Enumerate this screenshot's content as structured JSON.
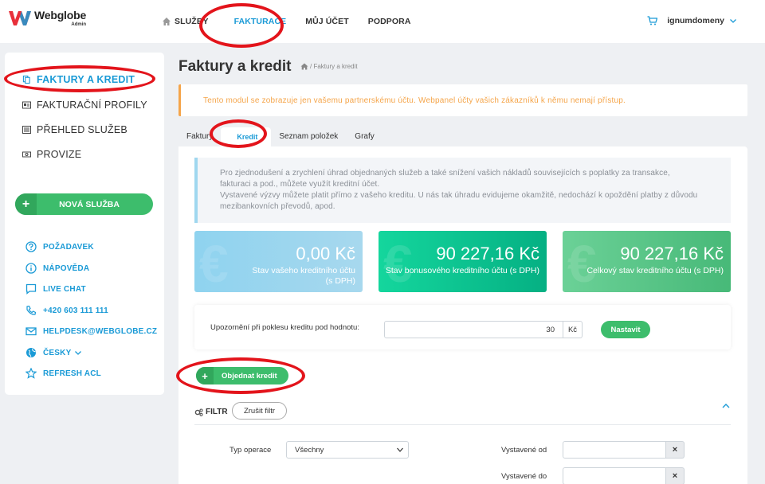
{
  "header": {
    "brand": "Webglobe",
    "brand_sub": "Admin",
    "nav": [
      "SLUŽBY",
      "FAKTURACE",
      "MŮJ ÚČET",
      "PODPORA"
    ],
    "user": "ignumdomeny"
  },
  "sidebar": {
    "items": [
      "FAKTURY A KREDIT",
      "FAKTURAČNÍ PROFILY",
      "PŘEHLED SLUŽEB",
      "PROVIZE"
    ],
    "new_service": "NOVÁ SLUŽBA",
    "help": [
      "POŽADAVEK",
      "NÁPOVĚDA",
      "LIVE CHAT",
      "+420 603 111 111",
      "HELPDESK@WEBGLOBE.CZ",
      "ČESKY",
      "REFRESH ACL"
    ]
  },
  "main": {
    "title": "Faktury a kredit",
    "breadcrumb": "/ Faktury a kredit",
    "alert": "Tento modul se zobrazuje jen vašemu partnerskému účtu. Webpanel účty vašich zákazníků k němu nemají přístup.",
    "tabs": [
      "Faktury",
      "Kredit",
      "Seznam položek",
      "Grafy"
    ],
    "info_line1": "Pro zjednodušení a zrychlení úhrad objednaných služeb a také snížení vašich nákladů souvisejících s poplatky za transakce,",
    "info_line2": "fakturaci a pod., můžete využít kreditní účet.",
    "info_line3": "Vystavené výzvy můžete platit přímo z vašeho kreditu. U nás tak úhradu evidujeme okamžitě, nedochází k opoždění platby z důvodu",
    "info_line4": "mezibankovních převodů, apod.",
    "cards": [
      {
        "amount": "0,00 Kč",
        "desc1": "Stav vašeho kreditního účtu",
        "desc2": "(s DPH)"
      },
      {
        "amount": "90 227,16 Kč",
        "desc1": "Stav bonusového kreditního účtu (s DPH)",
        "desc2": ""
      },
      {
        "amount": "90 227,16 Kč",
        "desc1": "Celkový stav kreditního účtu (s DPH)",
        "desc2": ""
      }
    ],
    "card_symbol": "€",
    "notify_label": "Upozornění při poklesu kreditu pod hodnotu:",
    "notify_value": "30",
    "notify_unit": "Kč",
    "notify_button": "Nastavit",
    "order_button": "Objednat kredit",
    "filter_label": "FILTR",
    "clear_filter": "Zrušit filtr",
    "type_label": "Typ operace",
    "type_value": "Všechny",
    "issued_from": "Vystavené od",
    "issued_to": "Vystavené do",
    "clear_symbol": "×"
  },
  "colors": {
    "accent": "#1a9ad6",
    "green": "#3dbd6c",
    "alert": "#f5a54a",
    "annotation": "#e3141b"
  }
}
